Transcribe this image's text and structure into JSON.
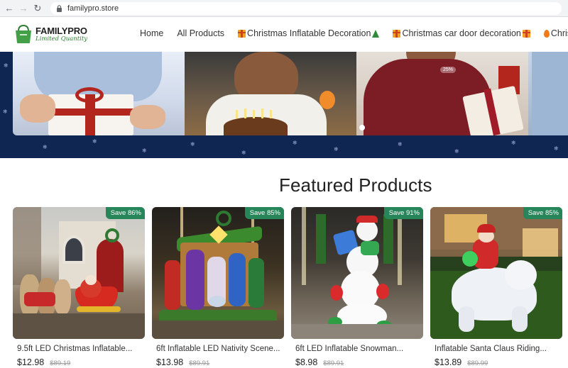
{
  "browser": {
    "url": "familypro.store"
  },
  "header": {
    "logo_title": "FAMILYPRO",
    "logo_subtitle": "Limited Quantity",
    "nav": [
      {
        "label": "Home"
      },
      {
        "label": "All Products"
      },
      {
        "label": "Christmas Inflatable Decoration"
      },
      {
        "label": "Christmas car door decoration"
      },
      {
        "label": "Christm"
      }
    ]
  },
  "hero": {
    "discount_badge": "25%",
    "active_slide": 1
  },
  "section": {
    "title": "Featured Products"
  },
  "products": [
    {
      "name": "9.5ft LED Christmas Inflatable...",
      "price": "$12.98",
      "old_price": "$89.19",
      "badge": "Save 86%"
    },
    {
      "name": "6ft Inflatable LED Nativity Scene...",
      "price": "$13.98",
      "old_price": "$89.91",
      "badge": "Save 85%"
    },
    {
      "name": "6ft LED Inflatable Snowman...",
      "price": "$8.98",
      "old_price": "$89.91",
      "badge": "Save 91%"
    },
    {
      "name": "Inflatable Santa Claus Riding...",
      "price": "$13.89",
      "old_price": "$89.99",
      "badge": "Save 85%"
    }
  ],
  "colors": {
    "brand_green": "#27855a",
    "hero_navy": "#0f2552"
  }
}
